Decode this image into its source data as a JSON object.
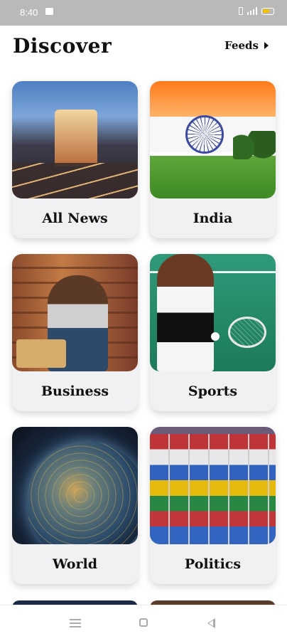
{
  "status_bar": {
    "time": "8:40"
  },
  "header": {
    "title": "Discover",
    "feeds_label": "Feeds"
  },
  "categories": [
    {
      "label": "All News"
    },
    {
      "label": "India"
    },
    {
      "label": "Business"
    },
    {
      "label": "Sports"
    },
    {
      "label": "World"
    },
    {
      "label": "Politics"
    }
  ],
  "colors": {
    "accent_battery": "#f2c200",
    "card_bg": "#f1f1f3",
    "status_bar": "#b9b9b9"
  },
  "icons": [
    "message-icon",
    "sim-icon",
    "signal-icon",
    "battery-icon",
    "chevron-right-icon",
    "menu-icon",
    "home-icon",
    "back-icon"
  ]
}
